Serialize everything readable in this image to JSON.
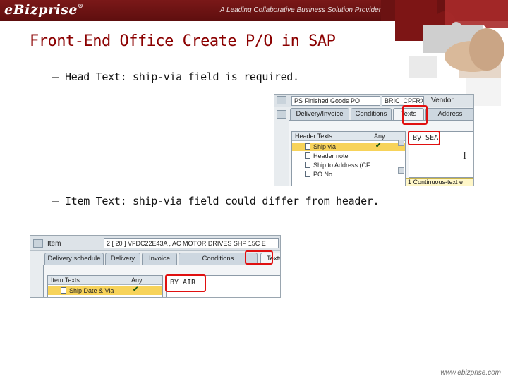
{
  "header": {
    "logo": "eBizprise",
    "logo_mark": "®",
    "tagline": "A Leading Collaborative Business Solution Provider"
  },
  "title": "Front-End Office Create P/O in SAP",
  "bullets": [
    {
      "dash": "–",
      "text": "Head Text: ship-via field is required."
    },
    {
      "dash": "–",
      "text": "Item Text: ship-via field could differ from header."
    }
  ],
  "header_screen": {
    "order_type": "PS Finished Goods PO",
    "vendor_id": "BRIC_CPFRX",
    "vendor_label": "Vendor",
    "tabs": [
      "Delivery/Invoice",
      "Conditions",
      "Texts",
      "Address"
    ],
    "active_tab": "Texts",
    "list_header": "Header Texts",
    "list_col2": "Any ...",
    "rows": [
      "Ship via",
      "Header note",
      "Ship to Address (CF",
      "PO No."
    ],
    "editor_text": "By SEA",
    "status": "1 Continuous-text e"
  },
  "item_screen": {
    "item_label": "Item",
    "item_value": "2 [ 20 ] VFDC22E43A , AC MOTOR DRIVES SHP 15C E",
    "tabs": [
      "Delivery schedule",
      "Delivery",
      "Invoice",
      "Conditions",
      "Texts"
    ],
    "active_tab": "Texts",
    "list_header": "Item Texts",
    "list_col2": "Any",
    "rows": [
      "Ship Date & Via"
    ],
    "editor_text": "BY AIR"
  },
  "footer": "www.ebizprise.com",
  "colors": {
    "banner": "#6b1212",
    "title": "#8b0000",
    "highlight": "#e01010",
    "selected_row": "#f7d35a"
  }
}
